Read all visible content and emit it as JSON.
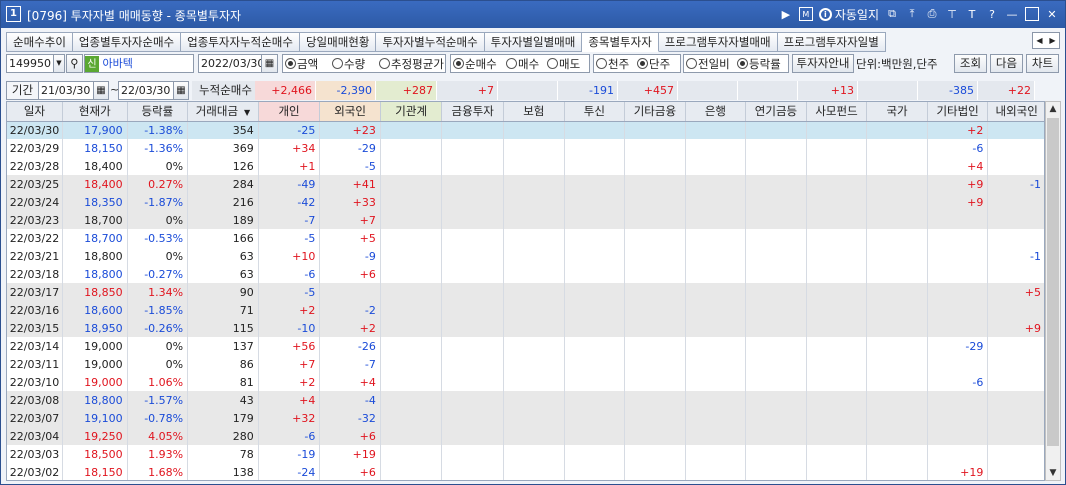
{
  "window": {
    "num": "1",
    "title": "[0796] 투자자별 매매동향 - 종목별투자자",
    "log_label": "자동일지",
    "log_icon": "i"
  },
  "tabs": [
    "순매수추이",
    "업종별투자자순매수",
    "업종투자자누적순매수",
    "당일매매현황",
    "투자자별누적순매수",
    "투자자별일별매매",
    "종목별투자자",
    "프로그램투자자별매매",
    "프로그램투자자일별"
  ],
  "active_tab": 6,
  "toolbar": {
    "code": "149950",
    "badge": "신",
    "name": "아바텍",
    "date": "2022/03/30",
    "radio1": [
      {
        "label": "금액",
        "on": true
      },
      {
        "label": "수량",
        "on": false
      },
      {
        "label": "추정평균가",
        "on": false
      }
    ],
    "radio2": [
      {
        "label": "순매수",
        "on": true
      },
      {
        "label": "매수",
        "on": false
      },
      {
        "label": "매도",
        "on": false
      }
    ],
    "radio3": [
      {
        "label": "천주",
        "on": false
      },
      {
        "label": "단주",
        "on": true
      }
    ],
    "radio4": [
      {
        "label": "전일비",
        "on": false
      },
      {
        "label": "등락률",
        "on": true
      }
    ],
    "guide_btn": "투자자안내",
    "unit": "단위:백만원,단주",
    "search_btn": "조회",
    "next_btn": "다음",
    "chart_btn": "차트"
  },
  "period": {
    "label": "기간",
    "start": "21/03/30",
    "end": "22/03/30",
    "tilde": "~",
    "cum_label": "누적순매수"
  },
  "sums": [
    "+2,466",
    "-2,390",
    "+287",
    "+7",
    "",
    "-191",
    "+457",
    "",
    "",
    "+13",
    "",
    "-385",
    "+22"
  ],
  "headers": [
    "일자",
    "현재가",
    "등락률",
    "거래대금",
    "개인",
    "외국인",
    "기관계",
    "금융투자",
    "보험",
    "투신",
    "기타금융",
    "은행",
    "연기금등",
    "사모펀드",
    "국가",
    "기타법인",
    "내외국인"
  ],
  "sort_icon": "▼",
  "rows": [
    [
      "22/03/30",
      "17,900",
      "-1.38%",
      "354",
      "-25",
      "+23",
      "",
      "",
      "",
      "",
      "",
      "",
      "",
      "",
      "",
      "+2",
      ""
    ],
    [
      "22/03/29",
      "18,150",
      "-1.36%",
      "369",
      "+34",
      "-29",
      "",
      "",
      "",
      "",
      "",
      "",
      "",
      "",
      "",
      "-6",
      ""
    ],
    [
      "22/03/28",
      "18,400",
      "0%",
      "126",
      "+1",
      "-5",
      "",
      "",
      "",
      "",
      "",
      "",
      "",
      "",
      "",
      "+4",
      ""
    ],
    [
      "22/03/25",
      "18,400",
      "0.27%",
      "284",
      "-49",
      "+41",
      "",
      "",
      "",
      "",
      "",
      "",
      "",
      "",
      "",
      "+9",
      "-1"
    ],
    [
      "22/03/24",
      "18,350",
      "-1.87%",
      "216",
      "-42",
      "+33",
      "",
      "",
      "",
      "",
      "",
      "",
      "",
      "",
      "",
      "+9",
      ""
    ],
    [
      "22/03/23",
      "18,700",
      "0%",
      "189",
      "-7",
      "+7",
      "",
      "",
      "",
      "",
      "",
      "",
      "",
      "",
      "",
      "",
      ""
    ],
    [
      "22/03/22",
      "18,700",
      "-0.53%",
      "166",
      "-5",
      "+5",
      "",
      "",
      "",
      "",
      "",
      "",
      "",
      "",
      "",
      "",
      ""
    ],
    [
      "22/03/21",
      "18,800",
      "0%",
      "63",
      "+10",
      "-9",
      "",
      "",
      "",
      "",
      "",
      "",
      "",
      "",
      "",
      "",
      "-1"
    ],
    [
      "22/03/18",
      "18,800",
      "-0.27%",
      "63",
      "-6",
      "+6",
      "",
      "",
      "",
      "",
      "",
      "",
      "",
      "",
      "",
      "",
      ""
    ],
    [
      "22/03/17",
      "18,850",
      "1.34%",
      "90",
      "-5",
      "",
      "",
      "",
      "",
      "",
      "",
      "",
      "",
      "",
      "",
      "",
      "+5"
    ],
    [
      "22/03/16",
      "18,600",
      "-1.85%",
      "71",
      "+2",
      "-2",
      "",
      "",
      "",
      "",
      "",
      "",
      "",
      "",
      "",
      "",
      ""
    ],
    [
      "22/03/15",
      "18,950",
      "-0.26%",
      "115",
      "-10",
      "+2",
      "",
      "",
      "",
      "",
      "",
      "",
      "",
      "",
      "",
      "",
      "+9"
    ],
    [
      "22/03/14",
      "19,000",
      "0%",
      "137",
      "+56",
      "-26",
      "",
      "",
      "",
      "",
      "",
      "",
      "",
      "",
      "",
      "-29",
      ""
    ],
    [
      "22/03/11",
      "19,000",
      "0%",
      "86",
      "+7",
      "-7",
      "",
      "",
      "",
      "",
      "",
      "",
      "",
      "",
      "",
      "",
      ""
    ],
    [
      "22/03/10",
      "19,000",
      "1.06%",
      "81",
      "+2",
      "+4",
      "",
      "",
      "",
      "",
      "",
      "",
      "",
      "",
      "",
      "-6",
      ""
    ],
    [
      "22/03/08",
      "18,800",
      "-1.57%",
      "43",
      "+4",
      "-4",
      "",
      "",
      "",
      "",
      "",
      "",
      "",
      "",
      "",
      "",
      ""
    ],
    [
      "22/03/07",
      "19,100",
      "-0.78%",
      "179",
      "+32",
      "-32",
      "",
      "",
      "",
      "",
      "",
      "",
      "",
      "",
      "",
      "",
      ""
    ],
    [
      "22/03/04",
      "19,250",
      "4.05%",
      "280",
      "-6",
      "+6",
      "",
      "",
      "",
      "",
      "",
      "",
      "",
      "",
      "",
      "",
      ""
    ],
    [
      "22/03/03",
      "18,500",
      "1.93%",
      "78",
      "-19",
      "+19",
      "",
      "",
      "",
      "",
      "",
      "",
      "",
      "",
      "",
      "",
      ""
    ],
    [
      "22/03/02",
      "18,150",
      "1.68%",
      "138",
      "-24",
      "+6",
      "",
      "",
      "",
      "",
      "",
      "",
      "",
      "",
      "",
      "+19",
      ""
    ]
  ],
  "row_style": [
    "sel",
    "even",
    "even",
    "odd",
    "odd",
    "odd",
    "even",
    "even",
    "even",
    "odd",
    "odd",
    "odd",
    "even",
    "even",
    "even",
    "odd",
    "odd",
    "odd",
    "even",
    "even"
  ],
  "price_dir": [
    "dn",
    "dn",
    "",
    "up",
    "dn",
    "",
    "dn",
    "",
    "dn",
    "up",
    "dn",
    "dn",
    "",
    "",
    "up",
    "dn",
    "dn",
    "up",
    "up",
    "up"
  ],
  "colors": {
    "up": "#e0141e",
    "down": "#1a4bd8",
    "selected": "#cde6f2",
    "title": "#2d5aa6"
  }
}
